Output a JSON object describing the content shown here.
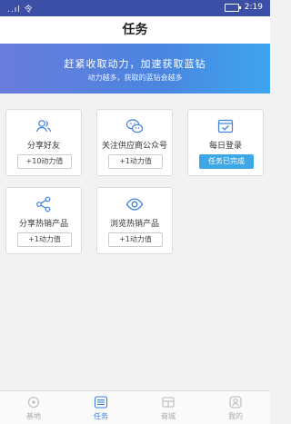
{
  "status_bar": {
    "signal": "..ıl 令",
    "time": "2:19"
  },
  "header": {
    "title": "任务"
  },
  "hero": {
    "line1": "赶紧收取动力，加速获取蓝钻",
    "line2": "动力越多，获取的蓝钻会越多"
  },
  "tasks": [
    {
      "label": "分享好友",
      "button": "+10动力值",
      "icon": "users-icon"
    },
    {
      "label": "关注供应商公众号",
      "button": "+1动力值",
      "icon": "wechat-icon"
    },
    {
      "label": "每日登录",
      "button": "任务已完成",
      "icon": "calendar-check-icon",
      "done": true
    },
    {
      "label": "分享热销产品",
      "button": "+1动力值",
      "icon": "share-icon"
    },
    {
      "label": "浏览热销产品",
      "button": "+1动力值",
      "icon": "eye-icon"
    }
  ],
  "tabbar": [
    {
      "label": "基地",
      "icon": "base-icon"
    },
    {
      "label": "任务",
      "icon": "list-icon",
      "active": true
    },
    {
      "label": "商城",
      "icon": "shop-icon"
    },
    {
      "label": "我的",
      "icon": "user-icon"
    }
  ],
  "colors": {
    "accent": "#3ea8e6",
    "hero_start": "#6a7bdc",
    "hero_end": "#3ea5ef",
    "tab_active": "#3f7fdc"
  }
}
